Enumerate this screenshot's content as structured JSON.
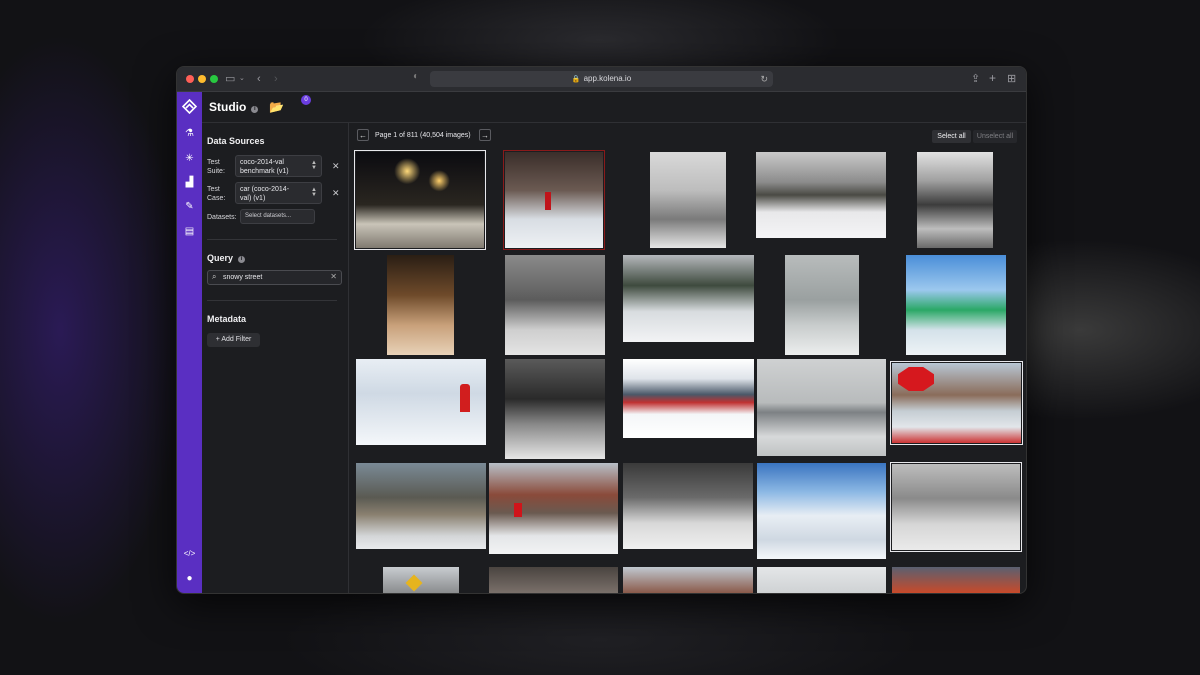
{
  "browser": {
    "url": "app.kolena.io"
  },
  "app": {
    "title": "Studio",
    "folder_badge": "0"
  },
  "sidebar": {
    "data_sources_title": "Data Sources",
    "test_suite_label_1": "Test",
    "test_suite_label_2": "Suite:",
    "test_suite_value_1": "coco-2014-val",
    "test_suite_value_2": "benchmark (v1)",
    "test_case_label_1": "Test",
    "test_case_label_2": "Case:",
    "test_case_value_1": "car (coco-2014-",
    "test_case_value_2": "val) (v1)",
    "datasets_label": "Datasets:",
    "datasets_placeholder": "Select datasets...",
    "query_title": "Query",
    "query_value": "snowy street",
    "metadata_title": "Metadata",
    "add_filter_label": "Add Filter"
  },
  "main": {
    "pagination_text": "Page 1 of 811 (40,504 images)",
    "select_all_label": "Select all",
    "unselect_all_label": "Unselect all"
  },
  "colors": {
    "accent": "#5a2fc2",
    "background": "#1c1d20"
  }
}
